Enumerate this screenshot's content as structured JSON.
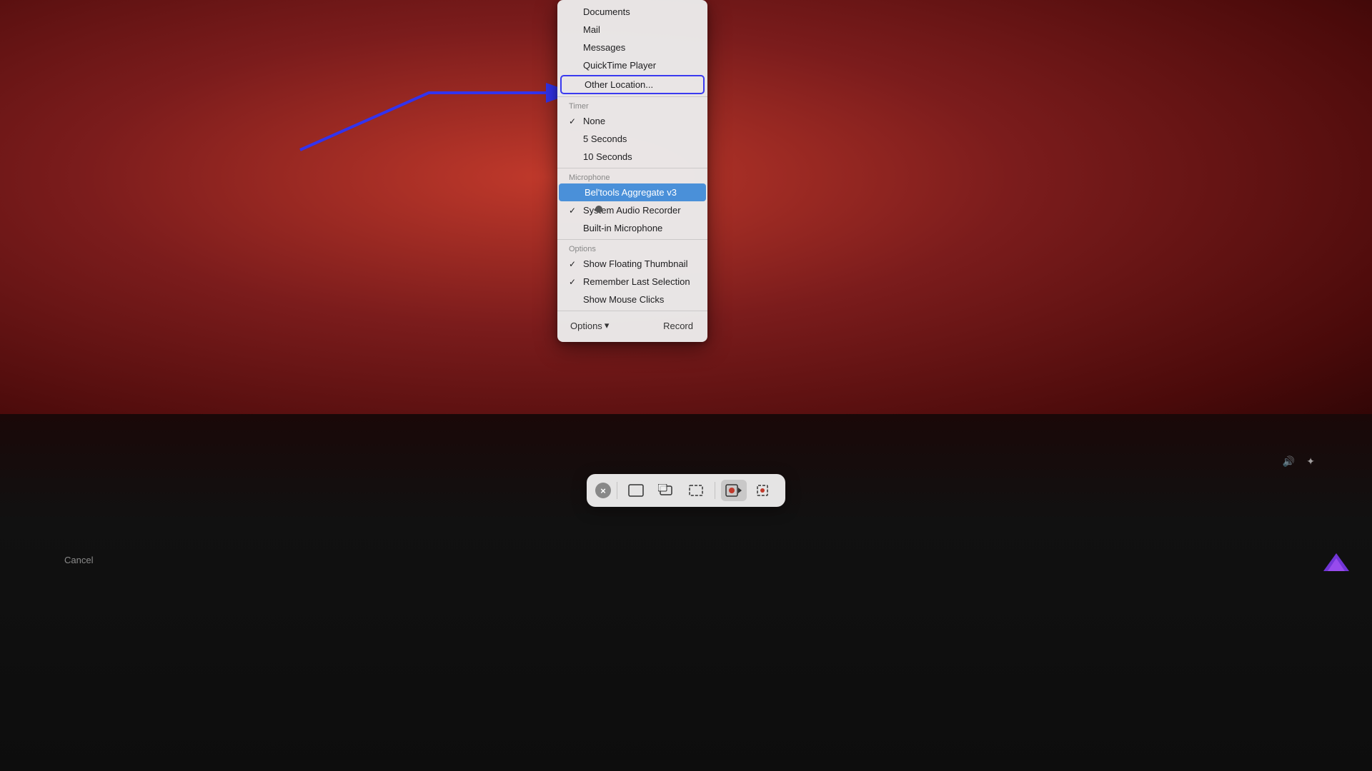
{
  "background": {
    "red_area_height": 620
  },
  "arrow": {
    "color": "#3333ee"
  },
  "dropdown": {
    "items_top": [
      {
        "id": "documents",
        "label": "Documents",
        "type": "item",
        "checked": false
      },
      {
        "id": "mail",
        "label": "Mail",
        "type": "item",
        "checked": false
      },
      {
        "id": "messages",
        "label": "Messages",
        "type": "item",
        "checked": false
      },
      {
        "id": "quicktime",
        "label": "QuickTime Player",
        "type": "item",
        "checked": false
      },
      {
        "id": "other-location",
        "label": "Other Location...",
        "type": "other-location",
        "checked": false
      }
    ],
    "timer_section": {
      "label": "Timer",
      "items": [
        {
          "id": "none",
          "label": "None",
          "checked": true
        },
        {
          "id": "5-seconds",
          "label": "5 Seconds",
          "checked": false
        },
        {
          "id": "10-seconds",
          "label": "10 Seconds",
          "checked": false
        }
      ]
    },
    "microphone_section": {
      "label": "Microphone",
      "items": [
        {
          "id": "mic-highlighted",
          "label": "Bel'tools Aggregate v3",
          "type": "highlighted",
          "checked": false
        },
        {
          "id": "system-audio",
          "label": "System Audio Recorder",
          "checked": true
        },
        {
          "id": "builtin-mic",
          "label": "Built-in Microphone",
          "checked": false
        }
      ]
    },
    "options_section": {
      "label": "Options",
      "items": [
        {
          "id": "show-floating-thumbnail",
          "label": "Show Floating Thumbnail",
          "checked": true
        },
        {
          "id": "remember-last-selection",
          "label": "Remember Last Selection",
          "checked": true
        },
        {
          "id": "show-mouse-clicks",
          "label": "Show Mouse Clicks",
          "checked": false
        }
      ]
    }
  },
  "toolbar": {
    "close_label": "×",
    "options_label": "Options",
    "options_chevron": "▾",
    "record_label": "Record",
    "buttons": [
      {
        "id": "capture-fullscreen",
        "icon": "⬜",
        "label": "Capture Entire Screen"
      },
      {
        "id": "capture-window",
        "icon": "▭",
        "label": "Capture Selected Window"
      },
      {
        "id": "capture-selection",
        "icon": "⬚",
        "label": "Capture Selected Portion"
      },
      {
        "id": "record-fullscreen",
        "icon": "⬤",
        "label": "Record Entire Screen",
        "active": true
      },
      {
        "id": "record-selection",
        "icon": "⊡",
        "label": "Record Selected Portion"
      }
    ]
  },
  "system": {
    "cancel_label": "Cancel"
  }
}
